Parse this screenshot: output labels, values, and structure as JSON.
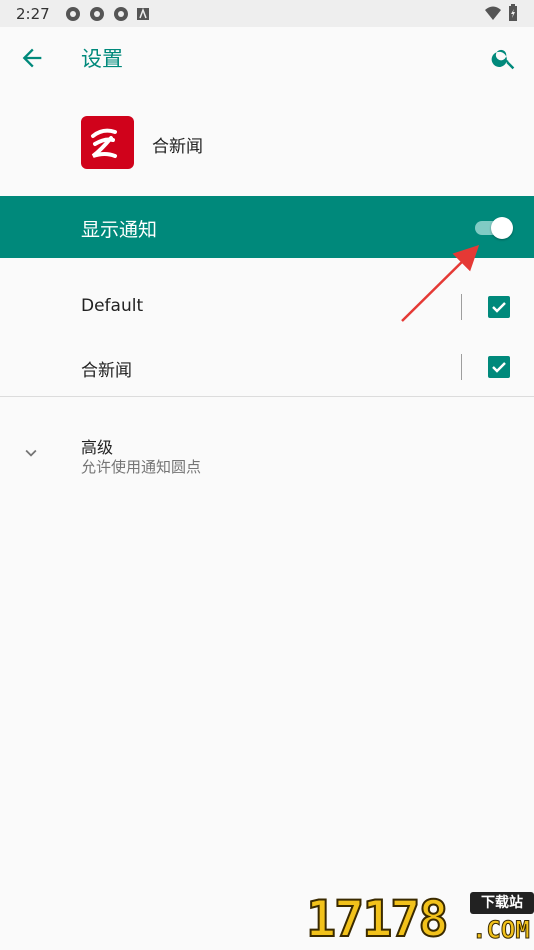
{
  "status_bar": {
    "time": "2:27"
  },
  "app_bar": {
    "title": "设置"
  },
  "app_info": {
    "app_name": "合新闻"
  },
  "main_toggle": {
    "label": "显示通知",
    "enabled": true
  },
  "channels": [
    {
      "label": "Default",
      "checked": true
    },
    {
      "label": "合新闻",
      "checked": true
    }
  ],
  "advanced": {
    "title": "高级",
    "subtitle": "允许使用通知圆点"
  },
  "watermark": {
    "number": "17178",
    "badge": "下载站",
    "suffix": ".COM"
  },
  "colors": {
    "accent": "#00897b",
    "toggle_track": "#80cbc4",
    "app_icon_bg": "#d0021b",
    "annotation_arrow": "#e53935"
  }
}
